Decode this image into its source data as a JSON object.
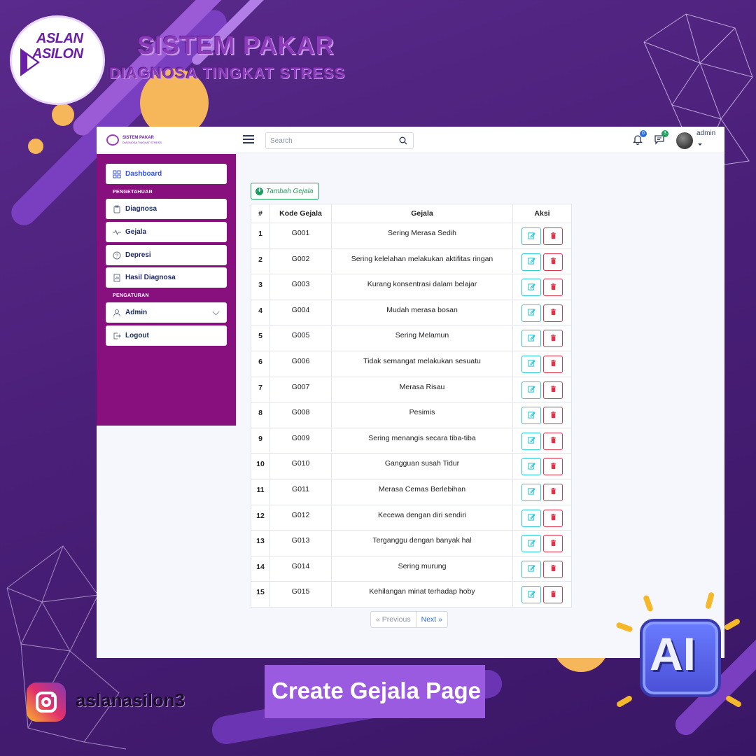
{
  "brand": {
    "logo_line1": "ASLAN",
    "logo_line2": "ASILON",
    "title": "SISTEM PAKAR",
    "subtitle": "DIAGNOSA TINGKAT STRESS"
  },
  "topbar": {
    "logo_title": "SISTEM PAKAR",
    "logo_subtitle": "DIAGNOSA TINGKAT STRESS",
    "search_placeholder": "Search",
    "notifications_count": "0",
    "messages_count": "3",
    "user_name": "admin"
  },
  "sidebar": {
    "dashboard": "Dashboard",
    "section_pengetahuan": "PENGETAHUAN",
    "diagnosa": "Diagnosa",
    "gejala": "Gejala",
    "depresi": "Depresi",
    "hasil_diagnosa": "Hasil Diagnosa",
    "section_pengaturan": "PENGATURAN",
    "admin": "Admin",
    "logout": "Logout"
  },
  "main": {
    "add_button": "Tambah Gejala",
    "columns": [
      "#",
      "Kode Gejala",
      "Gejala",
      "Aksi"
    ],
    "rows": [
      {
        "no": "1",
        "kode": "G001",
        "gejala": "Sering Merasa Sedih"
      },
      {
        "no": "2",
        "kode": "G002",
        "gejala": "Sering kelelahan melakukan aktifitas ringan"
      },
      {
        "no": "3",
        "kode": "G003",
        "gejala": "Kurang konsentrasi dalam belajar"
      },
      {
        "no": "4",
        "kode": "G004",
        "gejala": "Mudah merasa bosan"
      },
      {
        "no": "5",
        "kode": "G005",
        "gejala": "Sering Melamun"
      },
      {
        "no": "6",
        "kode": "G006",
        "gejala": "Tidak semangat melakukan sesuatu"
      },
      {
        "no": "7",
        "kode": "G007",
        "gejala": "Merasa Risau"
      },
      {
        "no": "8",
        "kode": "G008",
        "gejala": "Pesimis"
      },
      {
        "no": "9",
        "kode": "G009",
        "gejala": "Sering menangis secara tiba-tiba"
      },
      {
        "no": "10",
        "kode": "G010",
        "gejala": "Gangguan susah Tidur"
      },
      {
        "no": "11",
        "kode": "G011",
        "gejala": "Merasa Cemas Berlebihan"
      },
      {
        "no": "12",
        "kode": "G012",
        "gejala": "Kecewa dengan diri sendiri"
      },
      {
        "no": "13",
        "kode": "G013",
        "gejala": "Terganggu dengan banyak hal"
      },
      {
        "no": "14",
        "kode": "G014",
        "gejala": "Sering murung"
      },
      {
        "no": "15",
        "kode": "G015",
        "gejala": "Kehilangan minat terhadap hoby"
      }
    ],
    "pagination": {
      "prev": "« Previous",
      "next": "Next »"
    }
  },
  "overlay": {
    "caption": "Create Gejala Page",
    "instagram_handle": "aslanasilon3",
    "ai_badge": "AI"
  },
  "colors": {
    "sidebar_bg": "#87107e",
    "add_button": "#1e9e5c",
    "edit_button": "#2ec7d6",
    "delete_button": "#e0334b",
    "background": "#4a1f78"
  }
}
